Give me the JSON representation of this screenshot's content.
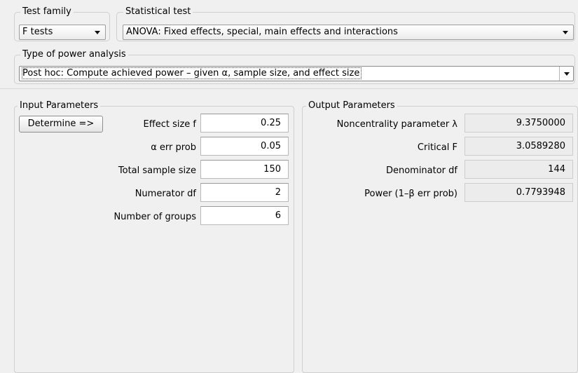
{
  "test_family": {
    "legend": "Test family",
    "value": "F tests"
  },
  "statistical_test": {
    "legend": "Statistical test",
    "value": "ANOVA: Fixed effects, special, main effects and interactions"
  },
  "power_analysis": {
    "legend": "Type of power analysis",
    "value": "Post hoc: Compute achieved power – given α, sample size, and effect size"
  },
  "input_parameters": {
    "legend": "Input Parameters",
    "determine_label": "Determine =>",
    "rows": [
      {
        "label": "Effect size f",
        "value": "0.25"
      },
      {
        "label": "α err prob",
        "value": "0.05"
      },
      {
        "label": "Total sample size",
        "value": "150"
      },
      {
        "label": "Numerator df",
        "value": "2"
      },
      {
        "label": "Number of groups",
        "value": "6"
      }
    ]
  },
  "output_parameters": {
    "legend": "Output Parameters",
    "rows": [
      {
        "label": "Noncentrality parameter λ",
        "value": "9.3750000"
      },
      {
        "label": "Critical F",
        "value": "3.0589280"
      },
      {
        "label": "Denominator df",
        "value": "144"
      },
      {
        "label": "Power (1–β err prob)",
        "value": "0.7793948"
      }
    ]
  },
  "icons": {
    "dropdown": "chevron-down-icon"
  }
}
